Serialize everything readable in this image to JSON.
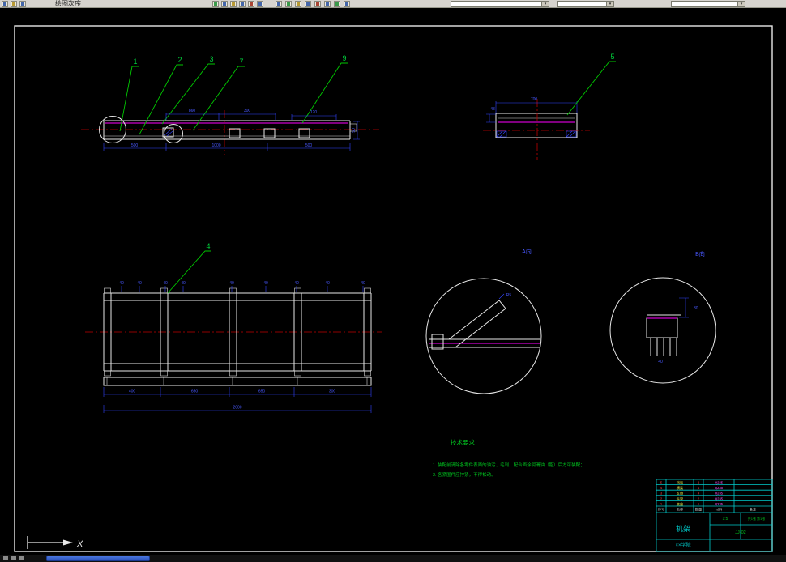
{
  "colors": {
    "canvas_bg": "#000000",
    "line_white": "#e8e8e8",
    "centerline_red": "#c00000",
    "leader_green": "#00c800",
    "dim_blue": "#3344ff",
    "detail_magenta": "#ff00ff",
    "titleblock_cyan": "#00cccc",
    "toolbar_bg": "#d6d3ce",
    "taskbar_blue": "#2a4fb8"
  },
  "toolbar": {
    "menu_label": "绘图次序",
    "icons": [
      "new-icon",
      "open-icon",
      "save-icon",
      "zoom-icon",
      "pan-icon",
      "undo-icon",
      "layers-icon",
      "color-icon"
    ],
    "combo_arrow": "▾"
  },
  "balloons": {
    "a": "1",
    "b": "2",
    "c": "3",
    "d": "7",
    "e": "9",
    "section": "5",
    "plan": "4"
  },
  "beam_dims": {
    "t1": "860",
    "t2": "300",
    "t3": "120",
    "r": "50",
    "b1": "500",
    "b2": "1000",
    "b3": "500"
  },
  "section_dims": {
    "width": "700",
    "flange": "48"
  },
  "plan_dims": {
    "d1": "400",
    "d2": "650",
    "d3": "650",
    "d4": "300",
    "total": "2000"
  },
  "plan_callouts": [
    "40",
    "40",
    "40",
    "40",
    "40",
    "40",
    "40",
    "40",
    "40"
  ],
  "details": {
    "a_label": "A向",
    "b_label": "B向",
    "a_dim": "R5",
    "b_dim1": "30",
    "b_dim2": "40"
  },
  "notes": {
    "title": "技术要求",
    "line1": "1. 装配前清除各零件表面的油污、毛刺，配合面涂润滑油（脂）后方可装配；",
    "line2": "2. 各紧固件应拧紧，不得松动。"
  },
  "titleblock": {
    "header": [
      "序号",
      "名称",
      "数量",
      "材料",
      "备注"
    ],
    "rows": [
      [
        "5",
        "挡板",
        "2",
        "Q235"
      ],
      [
        "4",
        "横梁",
        "4",
        "Q235"
      ],
      [
        "3",
        "支脚",
        "4",
        "Q235"
      ],
      [
        "2",
        "纵梁",
        "2",
        "Q235"
      ],
      [
        "1",
        "底座",
        "1",
        "Q235"
      ]
    ],
    "title": "机架",
    "scale": "1:5",
    "sheet": "共1张 第1张",
    "drawing_no": "JJ-02",
    "org": "××学院"
  },
  "ucs": {
    "x_label": "X"
  }
}
